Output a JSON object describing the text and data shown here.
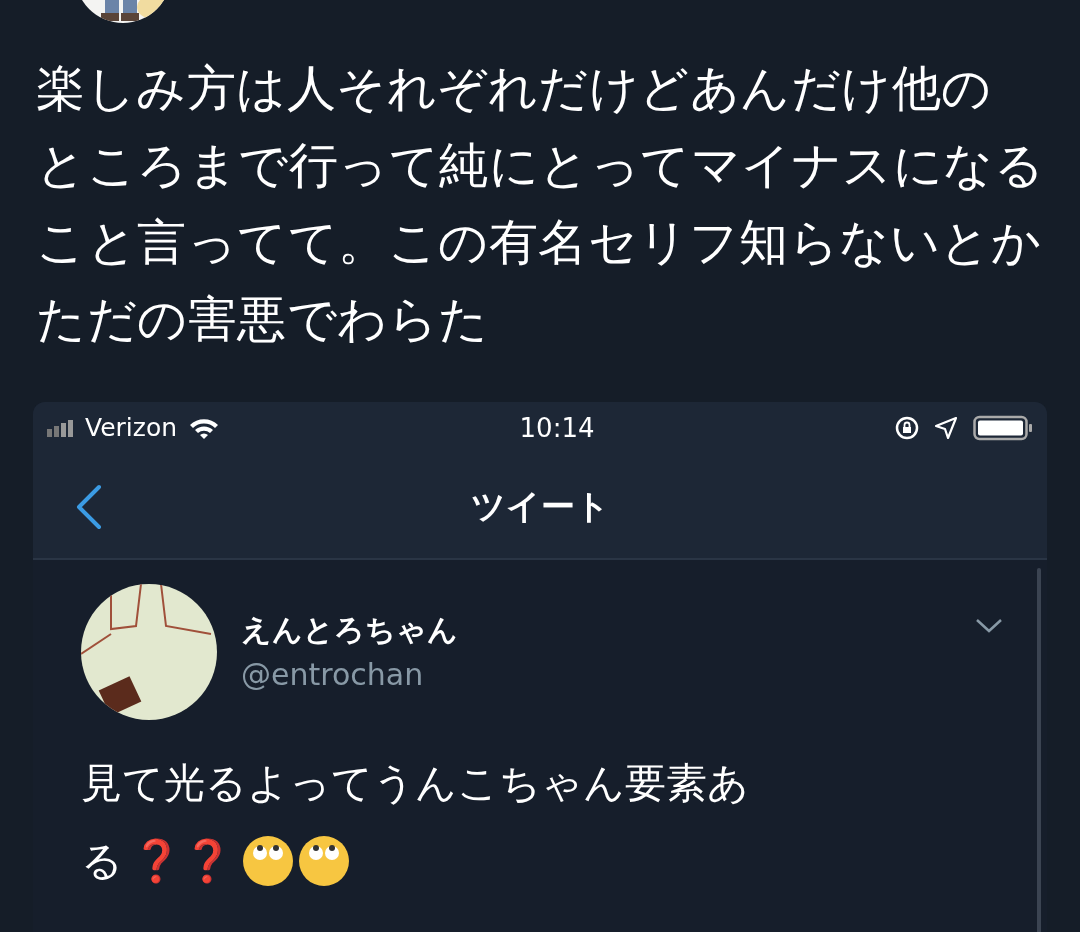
{
  "post": {
    "text_lines": [
      "楽しみ方は人それぞれだけどあんだけ他の",
      "ところまで行って純にとってマイナスになる",
      "こと言ってて。この有名セリフ知らないとか",
      "ただの害悪でわらた"
    ]
  },
  "embedded_screenshot": {
    "status_bar": {
      "carrier": "Verizon",
      "time": "10:14"
    },
    "nav": {
      "title": "ツイート"
    },
    "tweet": {
      "display_name": "えんとろちゃん",
      "handle": "@entrochan",
      "text_lines": [
        "見て光るよってうんこちゃん要素あ",
        "る"
      ],
      "question_marks": "❓❓"
    }
  }
}
